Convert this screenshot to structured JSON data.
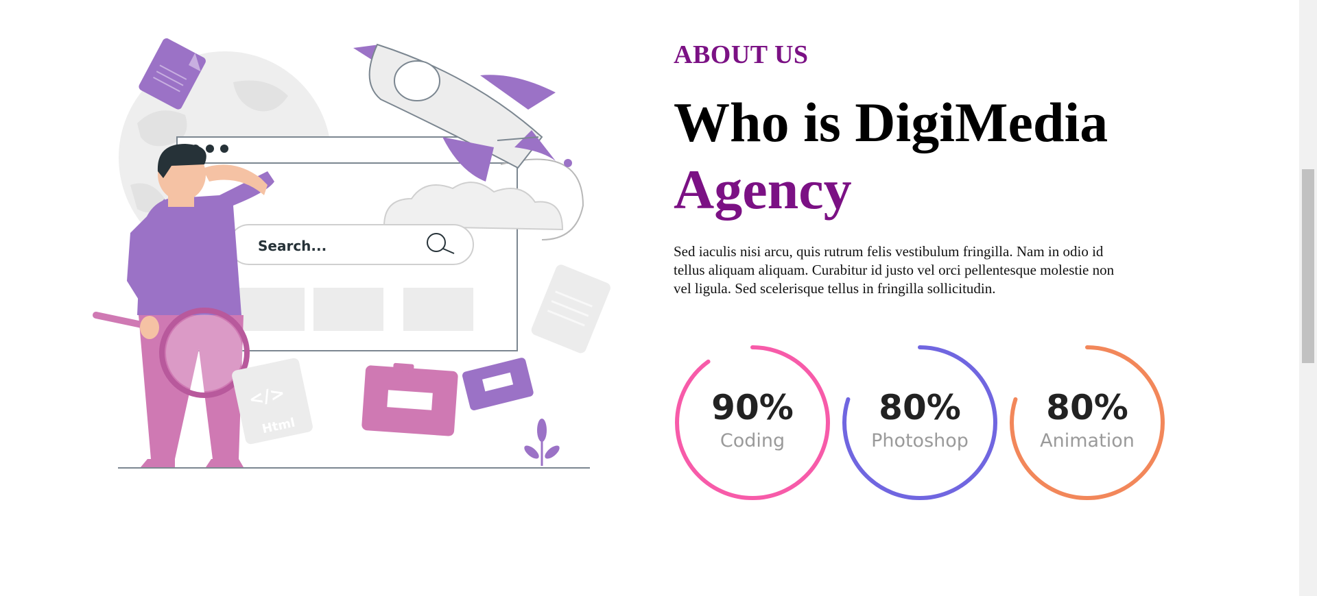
{
  "about": {
    "eyebrow": "ABOUT US",
    "headline_main": "Who is DigiMedia",
    "headline_accent": "Agency",
    "description": "Sed iaculis nisi arcu, quis rutrum felis vestibulum fringilla. Nam in odio id tellus aliquam aliquam. Curabitur id justo vel orci pellentesque molestie non vel ligula. Sed scelerisque tellus in fringilla sollicitudin."
  },
  "illustration": {
    "search_placeholder": "Search...",
    "html_label": "Html",
    "code_symbol": "</>"
  },
  "skills": [
    {
      "value": "90%",
      "label": "Coding",
      "percent": 90,
      "color": "#f75ba9"
    },
    {
      "value": "80%",
      "label": "Photoshop",
      "percent": 80,
      "color": "#7066e0"
    },
    {
      "value": "80%",
      "label": "Animation",
      "percent": 80,
      "color": "#f2875a"
    }
  ],
  "colors": {
    "accent_purple": "#7b1184",
    "illustration_purple": "#9b72c6",
    "illustration_pink": "#cf79b3"
  }
}
